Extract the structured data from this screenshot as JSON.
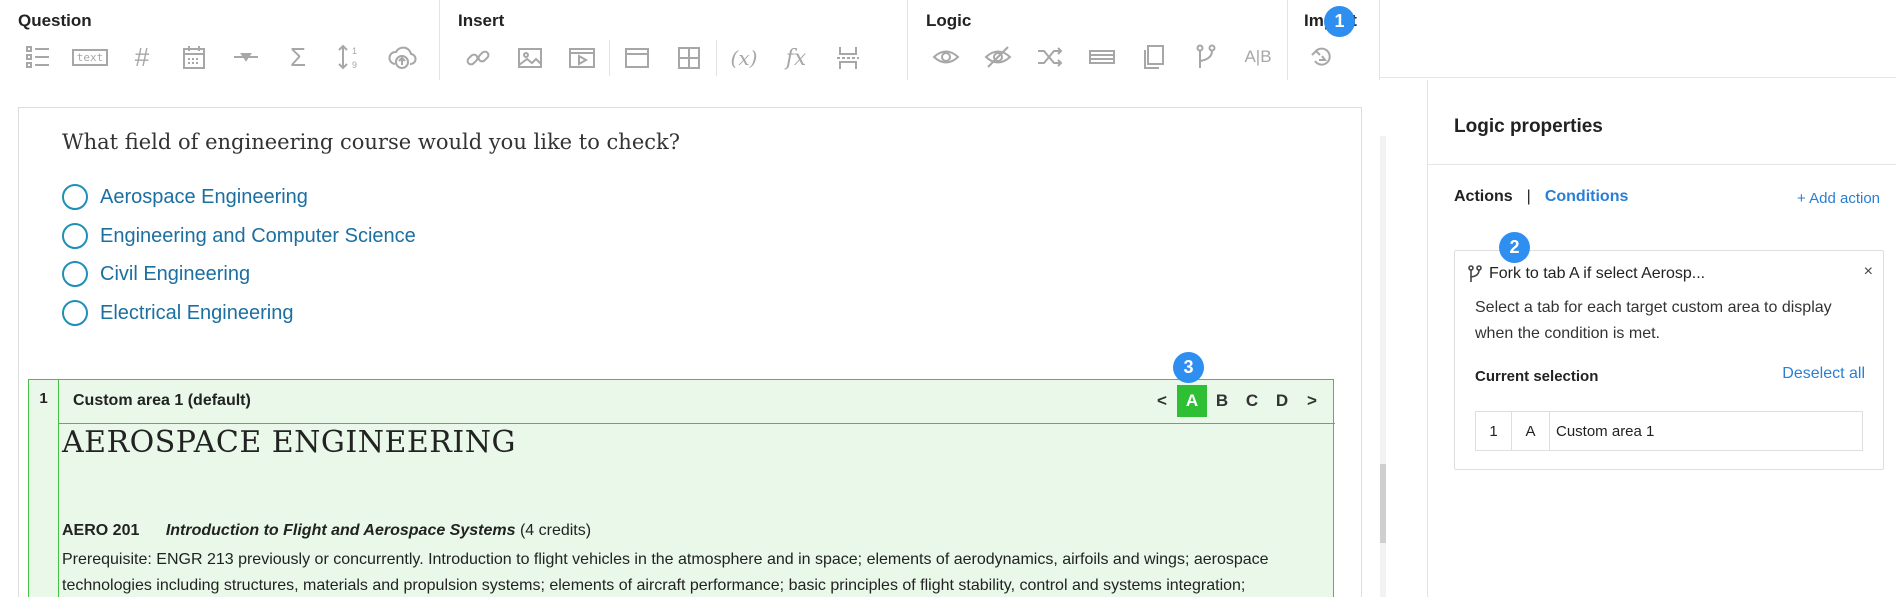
{
  "toolbar": {
    "groups": [
      {
        "title": "Question",
        "icons": [
          "list-icon",
          "text-field-icon",
          "number-icon",
          "calendar-icon",
          "slider-icon",
          "sum-icon",
          "ranking-icon",
          "upload-cloud-icon"
        ]
      },
      {
        "title": "Insert",
        "icons": [
          "link-icon",
          "image-icon",
          "video-icon",
          "layout-icon",
          "table-icon",
          "variable-icon",
          "function-icon",
          "page-break-icon"
        ]
      },
      {
        "title": "Logic",
        "icons": [
          "show-icon",
          "hide-icon",
          "shuffle-icon",
          "block-icon",
          "copy-icon",
          "fork-icon",
          "ab-test-icon"
        ]
      },
      {
        "title": "Import",
        "icons": [
          "import-icon"
        ]
      }
    ],
    "badges": [
      "1",
      "2",
      "3"
    ],
    "text_icon_label": "text",
    "ab_label": "A|B"
  },
  "question": {
    "text": "What field of engineering course would you like to check?",
    "options": [
      "Aerospace Engineering",
      "Engineering and Computer Science",
      "Civil Engineering",
      "Electrical Engineering"
    ]
  },
  "custom_area": {
    "number": "1",
    "title": "Custom area 1  (default)",
    "tabs": [
      "<",
      "A",
      "B",
      "C",
      "D",
      ">"
    ],
    "active_tab": "A",
    "heading": "AEROSPACE ENGINEERING",
    "course_code": "AERO 201",
    "course_title": "Introduction to Flight and Aerospace Systems",
    "course_credits": "(4 credits)",
    "description": "Prerequisite: ENGR 213 previously or concurrently. Introduction to flight vehicles in the atmosphere and in space; elements of aerodynamics, airfoils and wings; aerospace technologies including structures, materials and propulsion systems; elements of aircraft performance; basic principles of flight stability, control and systems integration;"
  },
  "panel": {
    "title": "Logic properties",
    "tab_actions": "Actions",
    "separator": "|",
    "tab_conditions": "Conditions",
    "add_action": "+ Add action",
    "card": {
      "title": "Fork to tab A if select Aerosp...",
      "close": "×",
      "help": "Select a tab for each target custom area to display when the condition is met.",
      "current_selection": "Current selection",
      "deselect_all": "Deselect all",
      "row": {
        "num": "1",
        "tab": "A",
        "area": "Custom area 1"
      }
    }
  },
  "colors": {
    "accent": "#2f8ff0",
    "active_tab": "#2fbf35",
    "area_bg": "#e9f8e9",
    "link": "#2a7fd4"
  }
}
